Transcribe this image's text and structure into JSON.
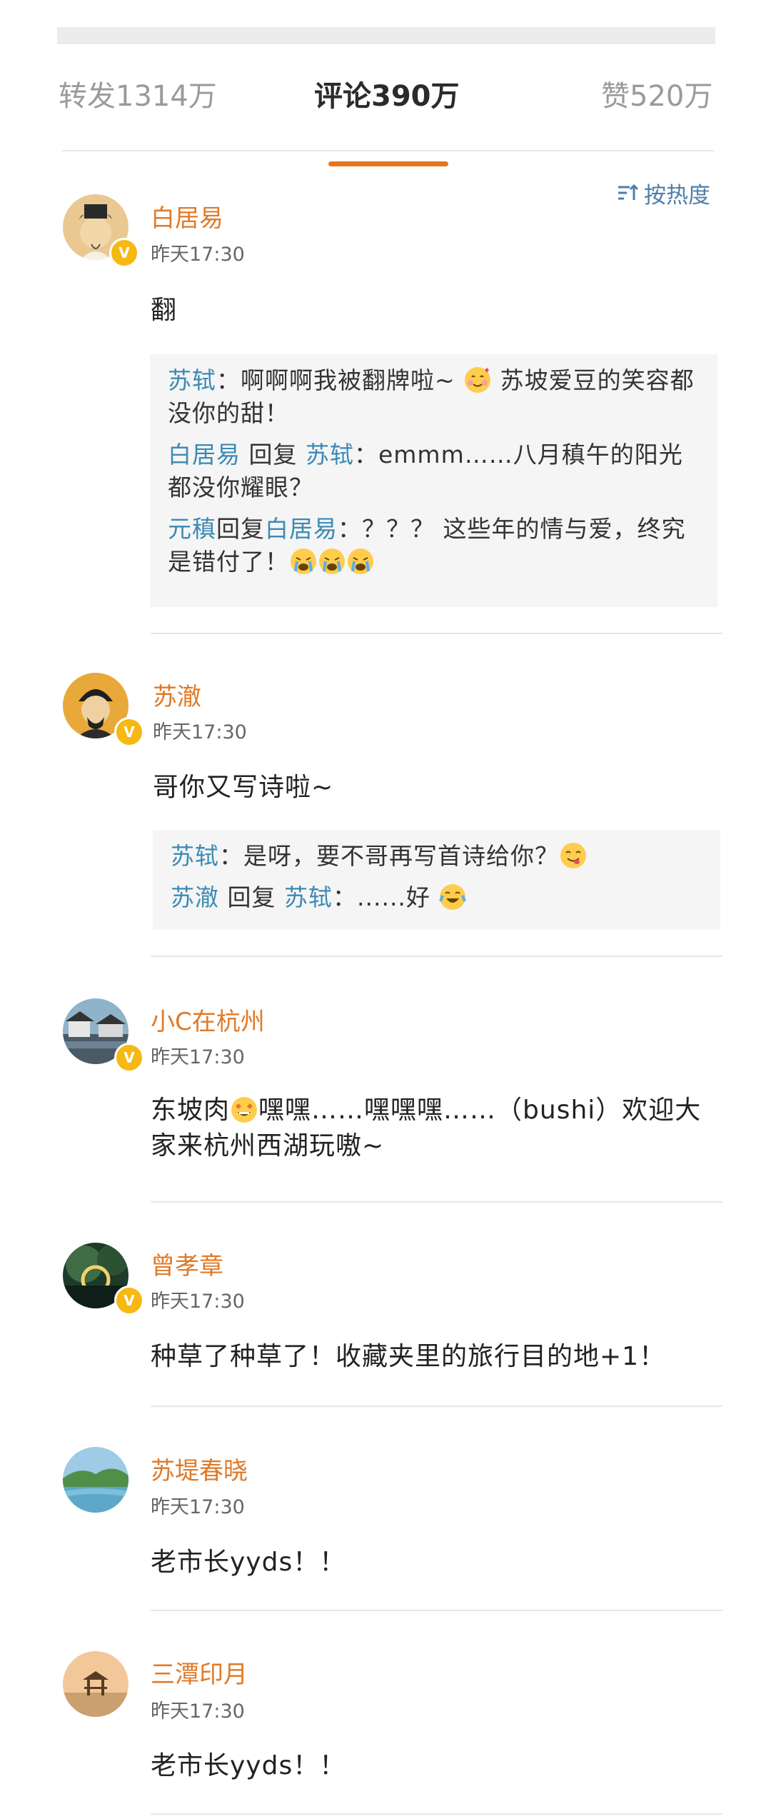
{
  "tabs": {
    "repost": "转发1314万",
    "comments": "评论390万",
    "likes": "赞520万"
  },
  "sort_label": "按热度",
  "comments": [
    {
      "name": "白居易",
      "time": "昨天17:30",
      "text": "翻",
      "replies": [
        {
          "parts": [
            {
              "t": "苏轼",
              "u": true
            },
            {
              "t": "：啊啊啊我被翻牌啦~ "
            },
            {
              "e": "smile"
            },
            {
              "t": " 苏坡爱豆的笑容都没你的甜！"
            }
          ]
        },
        {
          "parts": [
            {
              "t": "白居易",
              "u": true
            },
            {
              "t": " 回复 "
            },
            {
              "t": "苏轼",
              "u": true
            },
            {
              "t": "：emmm……八月稹午的阳光都没你耀眼？"
            }
          ]
        },
        {
          "parts": [
            {
              "t": "元稹",
              "u": true
            },
            {
              "t": "回复"
            },
            {
              "t": "白居易",
              "u": true
            },
            {
              "t": "：？？？ 这些年的情与爱，终究是错付了！"
            },
            {
              "e": "cry"
            },
            {
              "e": "cry"
            },
            {
              "e": "cry"
            }
          ]
        }
      ]
    },
    {
      "name": "苏澈",
      "time": "昨天17:30",
      "text": "哥你又写诗啦~",
      "replies": [
        {
          "parts": [
            {
              "t": "苏轼",
              "u": true
            },
            {
              "t": "：是呀，要不哥再写首诗给你？"
            },
            {
              "e": "yum"
            }
          ]
        },
        {
          "parts": [
            {
              "t": "苏澈",
              "u": true
            },
            {
              "t": " 回复 "
            },
            {
              "t": "苏轼",
              "u": true
            },
            {
              "t": "：......好 "
            },
            {
              "e": "laugh"
            }
          ]
        }
      ]
    },
    {
      "name": "小C在杭州",
      "time": "昨天17:30",
      "text_parts": [
        {
          "t": "东坡肉"
        },
        {
          "e": "star"
        },
        {
          "t": "嘿嘿……嘿嘿嘿……（bushi）欢迎大家来杭州西湖玩嗷~"
        }
      ],
      "replies": []
    },
    {
      "name": "曾孝章",
      "time": "昨天17:30",
      "text": "种草了种草了！收藏夹里的旅行目的地+1！",
      "replies": []
    },
    {
      "name": "苏堤春晓",
      "time": "昨天17:30",
      "text": "老市长yyds！！",
      "replies": []
    },
    {
      "name": "三潭印月",
      "time": "昨天17:30",
      "text": "老市长yyds！！",
      "replies": []
    }
  ],
  "icons": {
    "verified": "v-badge",
    "sort": "sort-icon"
  },
  "colors": {
    "accent": "#e8741e",
    "username": "#e07a28",
    "reply_user": "#3b8ab5",
    "sort": "#4e7fa8"
  }
}
